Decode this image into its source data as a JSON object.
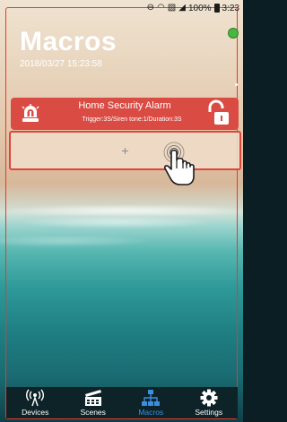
{
  "status_bar": {
    "battery_text": "100%",
    "time": "3:23"
  },
  "header": {
    "title": "Macros",
    "datetime": "2018/03/27 15:23:58"
  },
  "macros": [
    {
      "name": "Home Security Alarm",
      "detail": "Trigger:3S/Siren tone:1/Duration:3S",
      "color": "#d94b43",
      "icon": "siren-icon",
      "action_icon": "unlock-icon"
    }
  ],
  "add_macro": {
    "label": "+"
  },
  "nav": {
    "items": [
      {
        "label": "Devices",
        "icon": "wireless-device-icon",
        "active": false
      },
      {
        "label": "Scenes",
        "icon": "clapperboard-icon",
        "active": false
      },
      {
        "label": "Macros",
        "icon": "macro-network-icon",
        "active": true
      },
      {
        "label": "Settings",
        "icon": "gear-icon",
        "active": false
      }
    ],
    "active_color": "#3b8fe0"
  },
  "colors": {
    "accent_red": "#e23b2e",
    "online_indicator": "#46b83f"
  }
}
